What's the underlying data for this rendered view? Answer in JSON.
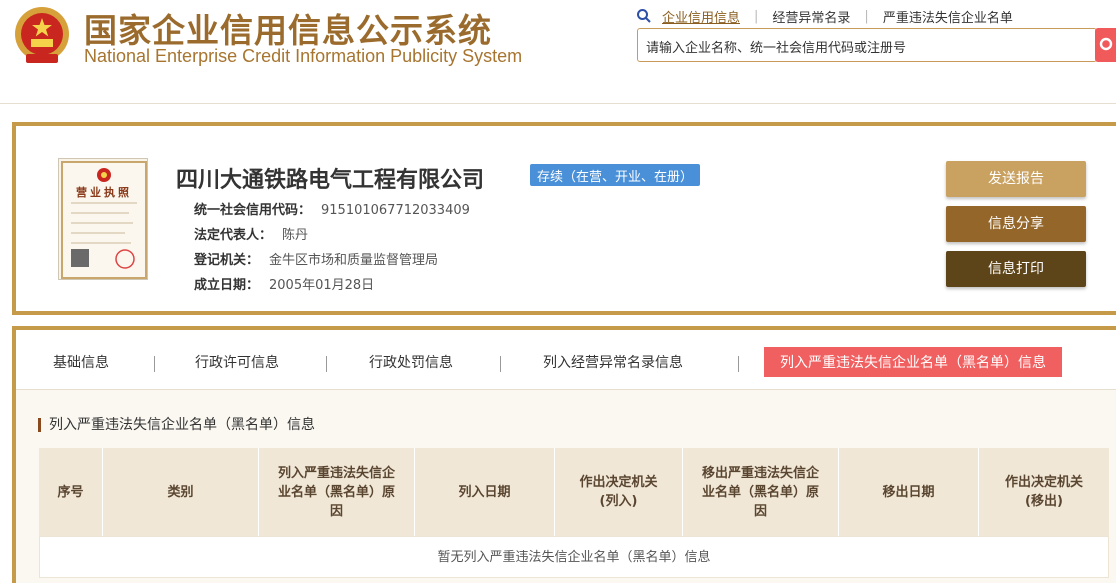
{
  "header": {
    "title_cn": "国家企业信用信息公示系统",
    "title_en": "National Enterprise Credit Information Publicity System",
    "links": [
      "企业信用信息",
      "经营异常名录",
      "严重违法失信企业名单"
    ],
    "search_placeholder": "请输入企业名称、统一社会信用代码或注册号"
  },
  "company": {
    "name": "四川大通铁路电气工程有限公司",
    "status": "存续（在营、开业、在册）",
    "fields": [
      {
        "label": "统一社会信用代码：",
        "value": "915101067712033409"
      },
      {
        "label": "法定代表人：",
        "value": "陈丹"
      },
      {
        "label": "登记机关：",
        "value": "金牛区市场和质量监督管理局"
      },
      {
        "label": "成立日期：",
        "value": "2005年01月28日"
      }
    ],
    "license_title": "营业执照"
  },
  "actions": [
    "发送报告",
    "信息分享",
    "信息打印"
  ],
  "tabs": [
    "基础信息",
    "行政许可信息",
    "行政处罚信息",
    "列入经营异常名录信息",
    "列入严重违法失信企业名单（黑名单）信息"
  ],
  "section_title": "列入严重违法失信企业名单（黑名单）信息",
  "table": {
    "columns": [
      "序号",
      "类别",
      "列入严重违法失信企业名单（黑名单）原因",
      "列入日期",
      "作出决定机关(列入)",
      "移出严重违法失信企业名单（黑名单）原因",
      "移出日期",
      "作出决定机关(移出)"
    ],
    "empty_text": "暂无列入严重违法失信企业名单（黑名单）信息"
  },
  "colors": {
    "brand_gold": "#c59a48",
    "active_tab": "#f06060",
    "status_blue": "#4a90d9",
    "btn_report": "#c9a160",
    "btn_share": "#946629",
    "btn_print": "#5e4419"
  }
}
